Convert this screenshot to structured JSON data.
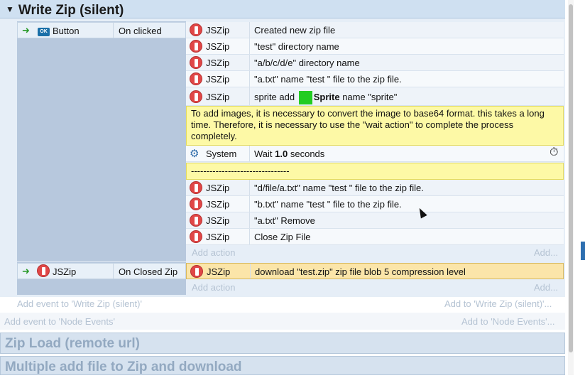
{
  "group": {
    "title": "Write Zip (silent)",
    "toggle": "▼"
  },
  "event1": {
    "object": "Button",
    "icon_label": "OK",
    "condition": "On clicked",
    "actions": [
      {
        "object": "JSZip",
        "text": "Created new zip file"
      },
      {
        "object": "JSZip",
        "text": "\"test\" directory name"
      },
      {
        "object": "JSZip",
        "text": "\"a/b/c/d/e\" directory name"
      },
      {
        "object": "JSZip",
        "text": "\"a.txt\" name \"test \" file to the zip file."
      }
    ],
    "sprite_action": {
      "object": "JSZip",
      "prefix": "sprite add",
      "sprite_name": "Sprite",
      "suffix": "name \"sprite\""
    },
    "comment1": "To add images, it is necessary to convert the image to base64 format. this takes a long time. Therefore, it is necessary to use the \"wait action\" to complete the process completely.",
    "wait_action": {
      "object": "System",
      "prefix": "Wait",
      "value": "1.0",
      "suffix": "seconds"
    },
    "comment2": "--------------------------------",
    "actions2": [
      {
        "object": "JSZip",
        "text": "\"d/file/a.txt\" name \"test \" file to the zip file."
      },
      {
        "object": "JSZip",
        "text": "\"b.txt\" name \"test \" file to the zip file."
      },
      {
        "object": "JSZip",
        "text": "\"a.txt\" Remove"
      },
      {
        "object": "JSZip",
        "text": "Close Zip File"
      }
    ],
    "add_action": "Add action",
    "add_more": "Add..."
  },
  "event2": {
    "object": "JSZip",
    "condition": "On Closed Zip",
    "action": {
      "object": "JSZip",
      "text": "download \"test.zip\" zip file blob 5 compression level"
    },
    "add_action": "Add action",
    "add_more": "Add..."
  },
  "footer": {
    "add_event_group": "Add event to 'Write Zip (silent)'",
    "add_to_group": "Add to 'Write Zip (silent)'...",
    "add_event_node": "Add event to 'Node Events'",
    "add_to_node": "Add to 'Node Events'..."
  },
  "collapsed_groups": [
    "Zip Load (remote url)",
    "Multiple add file to Zip and download"
  ],
  "colors": {
    "group_header": "#cfe0f1",
    "comment": "#fdf9a6",
    "sprite": "#22cc22",
    "jszip_icon": "#e04747"
  }
}
